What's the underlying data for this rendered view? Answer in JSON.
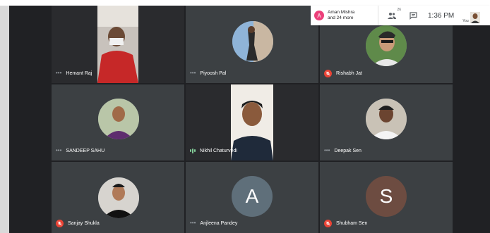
{
  "topbar": {
    "presenter_initial": "A",
    "presenter_line1": "Aman Mishra",
    "presenter_line2": "and 24 more",
    "people_count": "26",
    "time": "1:36 PM",
    "self_label": "You"
  },
  "participants": [
    {
      "name": "Hemant Raj",
      "mic": "on",
      "view": "video"
    },
    {
      "name": "Piyoosh Pal",
      "mic": "on",
      "view": "photo"
    },
    {
      "name": "Rishabh Jat",
      "mic": "muted",
      "view": "photo"
    },
    {
      "name": "SANDEEP SAHU",
      "mic": "on",
      "view": "photo"
    },
    {
      "name": "Nikhil Chaturvedi",
      "mic": "speaking",
      "view": "video"
    },
    {
      "name": "Deepak Sen",
      "mic": "on",
      "view": "photo"
    },
    {
      "name": "Sanjay Shukla",
      "mic": "muted",
      "view": "photo"
    },
    {
      "name": "Anjleena Pandey",
      "mic": "on",
      "view": "letter",
      "letter": "A",
      "color": "#5f6f7a"
    },
    {
      "name": "Shubham Sen",
      "mic": "muted",
      "view": "letter",
      "letter": "S",
      "color": "#6d4c41"
    }
  ],
  "colors": {
    "background": "#202124",
    "muted_red": "#ea4335",
    "speaking_green": "#81c995"
  }
}
